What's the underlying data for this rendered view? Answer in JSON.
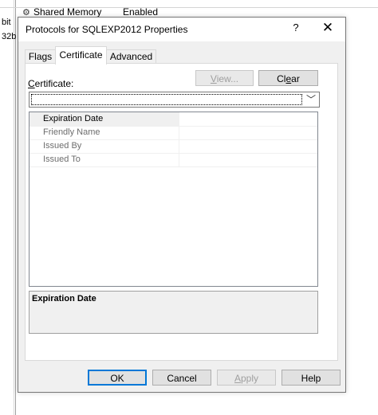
{
  "background": {
    "row_label": "Shared Memory",
    "row_value": "Enabled",
    "left_text_1": "bit",
    "left_text_2": "32b"
  },
  "dialog": {
    "title": "Protocols for SQLEXP2012 Properties",
    "help_glyph": "?",
    "close_glyph": "✕",
    "tabs": [
      {
        "label": "Flags",
        "active": false
      },
      {
        "label": "Certificate",
        "active": true
      },
      {
        "label": "Advanced",
        "active": false
      }
    ],
    "certificate": {
      "label_prefix": "C",
      "label_rest": "ertificate:",
      "view_button_prefix": "V",
      "view_button_rest": "iew...",
      "clear_button_prefix": "Cl",
      "clear_button_accel": "e",
      "clear_button_rest": "ar",
      "combo_value": "",
      "combo_arrow": "﹀"
    },
    "property_list": [
      {
        "name": "Expiration Date",
        "value": "",
        "selected": true
      },
      {
        "name": "Friendly Name",
        "value": "",
        "selected": false
      },
      {
        "name": "Issued By",
        "value": "",
        "selected": false
      },
      {
        "name": "Issued To",
        "value": "",
        "selected": false
      }
    ],
    "description": {
      "title": "Expiration Date"
    },
    "footer": {
      "ok_label": "OK",
      "cancel_label": "Cancel",
      "apply_accel": "A",
      "apply_rest": "pply",
      "help_label": "Help"
    }
  }
}
